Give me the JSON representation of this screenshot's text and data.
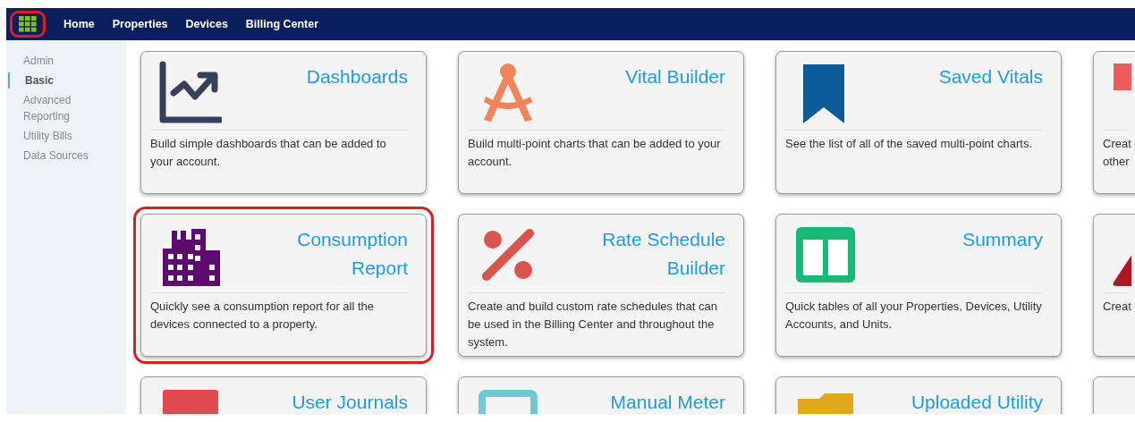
{
  "app_menu": {
    "highlighted": true
  },
  "nav": {
    "items": [
      "Home",
      "Properties",
      "Devices",
      "Billing Center"
    ]
  },
  "sidebar": {
    "items": [
      {
        "label": "Admin",
        "selected": false
      },
      {
        "label": "Basic",
        "selected": true
      },
      {
        "label": "Advanced Reporting",
        "selected": false
      },
      {
        "label": "Utility Bills",
        "selected": false
      },
      {
        "label": "Data Sources",
        "selected": false
      }
    ]
  },
  "cards": [
    {
      "kind": "chart",
      "title": "Dashboards",
      "description": "Build simple dashboards that can be added to your account.",
      "highlighted": false
    },
    {
      "kind": "compass",
      "title": "Vital Builder",
      "description": "Build multi-point charts that can be added to your account.",
      "highlighted": false
    },
    {
      "kind": "bookmark",
      "title": "Saved Vitals",
      "description": "See the list of all of the saved multi-point charts.",
      "highlighted": false
    },
    {
      "kind": "tag",
      "description": "Creat other",
      "highlighted": false
    },
    {
      "kind": "building",
      "title": "Consumption Report",
      "description": "Quickly see a consumption report for all the devices connected to a property.",
      "highlighted": true
    },
    {
      "kind": "percent",
      "title": "Rate Schedule Builder",
      "description": "Create and build custom rate schedules that can be used in the Billing Center and throughout the system.",
      "highlighted": false
    },
    {
      "kind": "columns",
      "title": "Summary",
      "description": "Quick tables of all your Properties, Devices, Utility Accounts, and Units.",
      "highlighted": false
    },
    {
      "kind": "triangle",
      "description": "Creat",
      "highlighted": false
    },
    {
      "kind": "block",
      "title": "User Journals",
      "highlighted": false
    },
    {
      "kind": "monitor",
      "title": "Manual Meter",
      "highlighted": false
    },
    {
      "kind": "folder",
      "title": "Uploaded Utility",
      "highlighted": false
    },
    {
      "kind": "blank",
      "highlighted": false
    }
  ]
}
